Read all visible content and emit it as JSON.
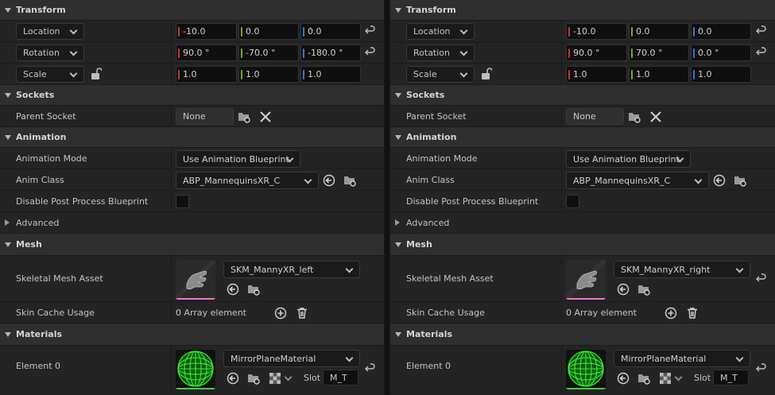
{
  "panels": [
    {
      "id": "left",
      "transform": {
        "header": "Transform",
        "location": {
          "mode": "Location",
          "x": "-10.0",
          "y": "0.0",
          "z": "0.0"
        },
        "rotation": {
          "mode": "Rotation",
          "x": "90.0 °",
          "y": "-70.0 °",
          "z": "-180.0 °"
        },
        "scale": {
          "mode": "Scale",
          "x": "1.0",
          "y": "1.0",
          "z": "1.0"
        }
      },
      "sockets": {
        "header": "Sockets",
        "parent_socket_label": "Parent Socket",
        "parent_socket_value": "None"
      },
      "animation": {
        "header": "Animation",
        "mode_label": "Animation Mode",
        "mode_value": "Use Animation Blueprint",
        "class_label": "Anim Class",
        "class_value": "ABP_MannequinsXR_C",
        "disable_pp_label": "Disable Post Process Blueprint",
        "advanced_label": "Advanced"
      },
      "mesh": {
        "header": "Mesh",
        "asset_label": "Skeletal Mesh Asset",
        "asset_value": "SKM_MannyXR_left",
        "skin_label": "Skin Cache Usage",
        "skin_value": "0 Array element"
      },
      "materials": {
        "header": "Materials",
        "element_label": "Element 0",
        "element_value": "MirrorPlaneMaterial",
        "slot_label": "Slot",
        "slot_value": "M_T"
      }
    },
    {
      "id": "right",
      "transform": {
        "header": "Transform",
        "location": {
          "mode": "Location",
          "x": "-10.0",
          "y": "0.0",
          "z": "0.0"
        },
        "rotation": {
          "mode": "Rotation",
          "x": "90.0 °",
          "y": "70.0 °",
          "z": "0.0 °"
        },
        "scale": {
          "mode": "Scale",
          "x": "1.0",
          "y": "1.0",
          "z": "1.0"
        }
      },
      "sockets": {
        "header": "Sockets",
        "parent_socket_label": "Parent Socket",
        "parent_socket_value": "None"
      },
      "animation": {
        "header": "Animation",
        "mode_label": "Animation Mode",
        "mode_value": "Use Animation Blueprint",
        "class_label": "Anim Class",
        "class_value": "ABP_MannequinsXR_C",
        "disable_pp_label": "Disable Post Process Blueprint",
        "advanced_label": "Advanced"
      },
      "mesh": {
        "header": "Mesh",
        "asset_label": "Skeletal Mesh Asset",
        "asset_value": "SKM_MannyXR_right",
        "skin_label": "Skin Cache Usage",
        "skin_value": "0 Array element"
      },
      "materials": {
        "header": "Materials",
        "element_label": "Element 0",
        "element_value": "MirrorPlaneMaterial",
        "slot_label": "Slot",
        "slot_value": "M_T"
      }
    }
  ],
  "colors": {
    "axis_x": "#c0392b",
    "axis_y": "#6cae21",
    "axis_z": "#2f7ad6",
    "mesh_thumb_stripe": "#e87ac8",
    "material_thumb_stripe": "#49c649"
  }
}
